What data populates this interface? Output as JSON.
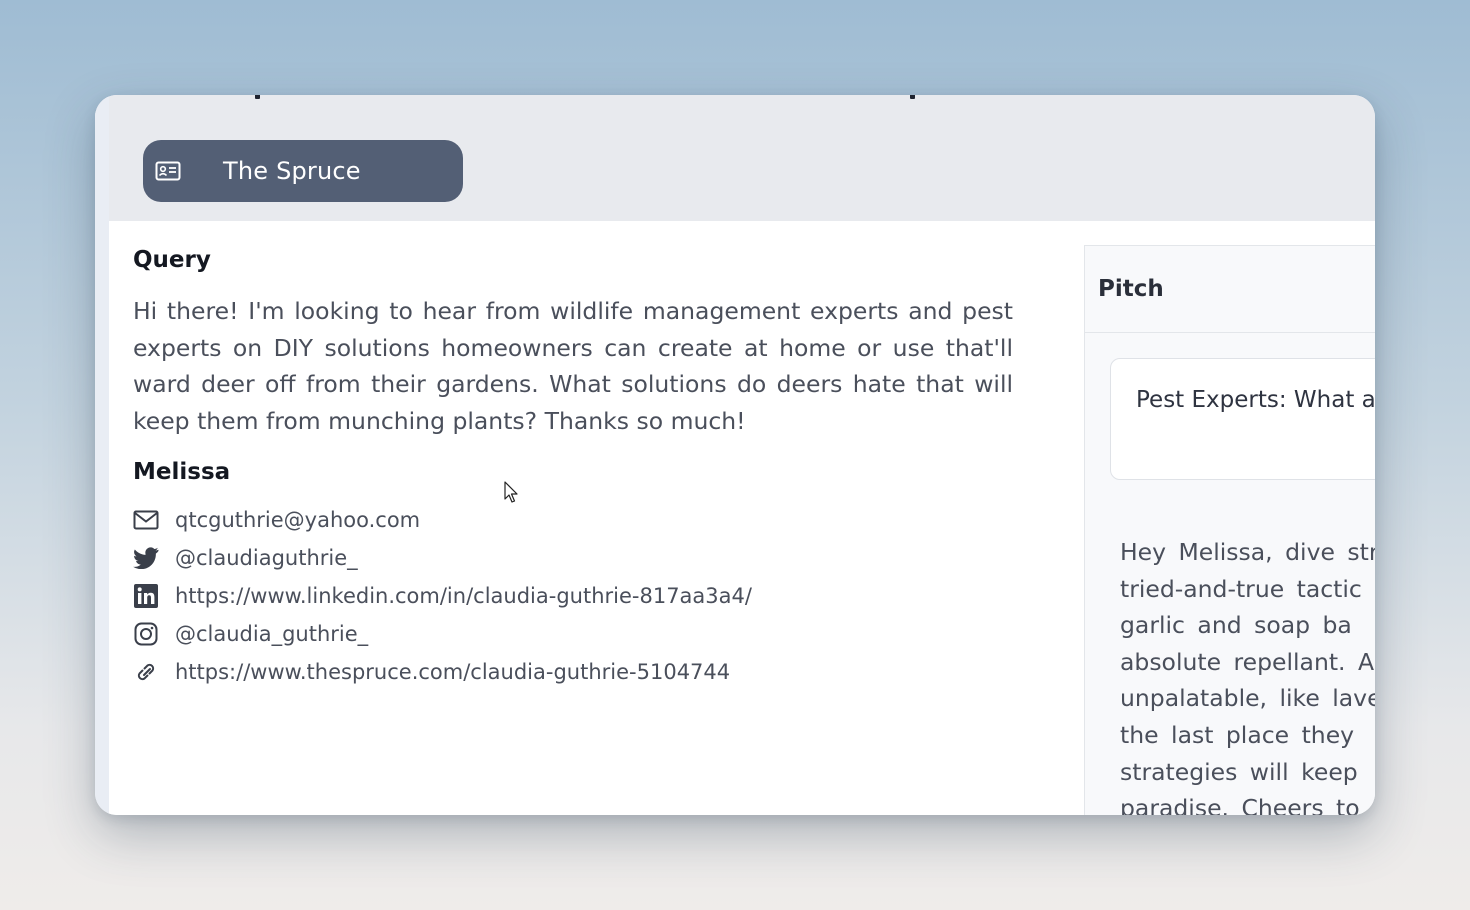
{
  "source": {
    "name": "The Spruce",
    "icon": "id-card-icon"
  },
  "query": {
    "heading": "Query",
    "text": "Hi there! I'm looking to hear from wildlife management experts and pest experts on DIY solutions homeowners can create at home or use that'll ward deer off from their gardens. What solutions do deers hate that will keep them from munching plants? Thanks so much!"
  },
  "journalist": {
    "name": "Melissa",
    "contacts": [
      {
        "icon": "mail-icon",
        "value": "qtcguthrie@yahoo.com"
      },
      {
        "icon": "twitter-icon",
        "value": "@claudiaguthrie_"
      },
      {
        "icon": "linkedin-icon",
        "value": "https://www.linkedin.com/in/claudia-guthrie-817aa3a4/"
      },
      {
        "icon": "instagram-icon",
        "value": "@claudia_guthrie_"
      },
      {
        "icon": "link-icon",
        "value": "https://www.thespruce.com/claudia-guthrie-5104744"
      }
    ]
  },
  "pitch": {
    "heading": "Pitch",
    "subject": "Pest Experts: What a",
    "body_lines": [
      "Hey Melissa, dive stra",
      "tried-and-true tactic",
      "garlic and soap ba",
      "absolute repellant. A",
      "unpalatable, like lave",
      "the last place they",
      "strategies will keep",
      "paradise. Cheers to a"
    ]
  },
  "colors": {
    "pill": "#535f75",
    "top_band": "#e8eaee",
    "text": "#4a4f5b",
    "heading": "#141821"
  }
}
